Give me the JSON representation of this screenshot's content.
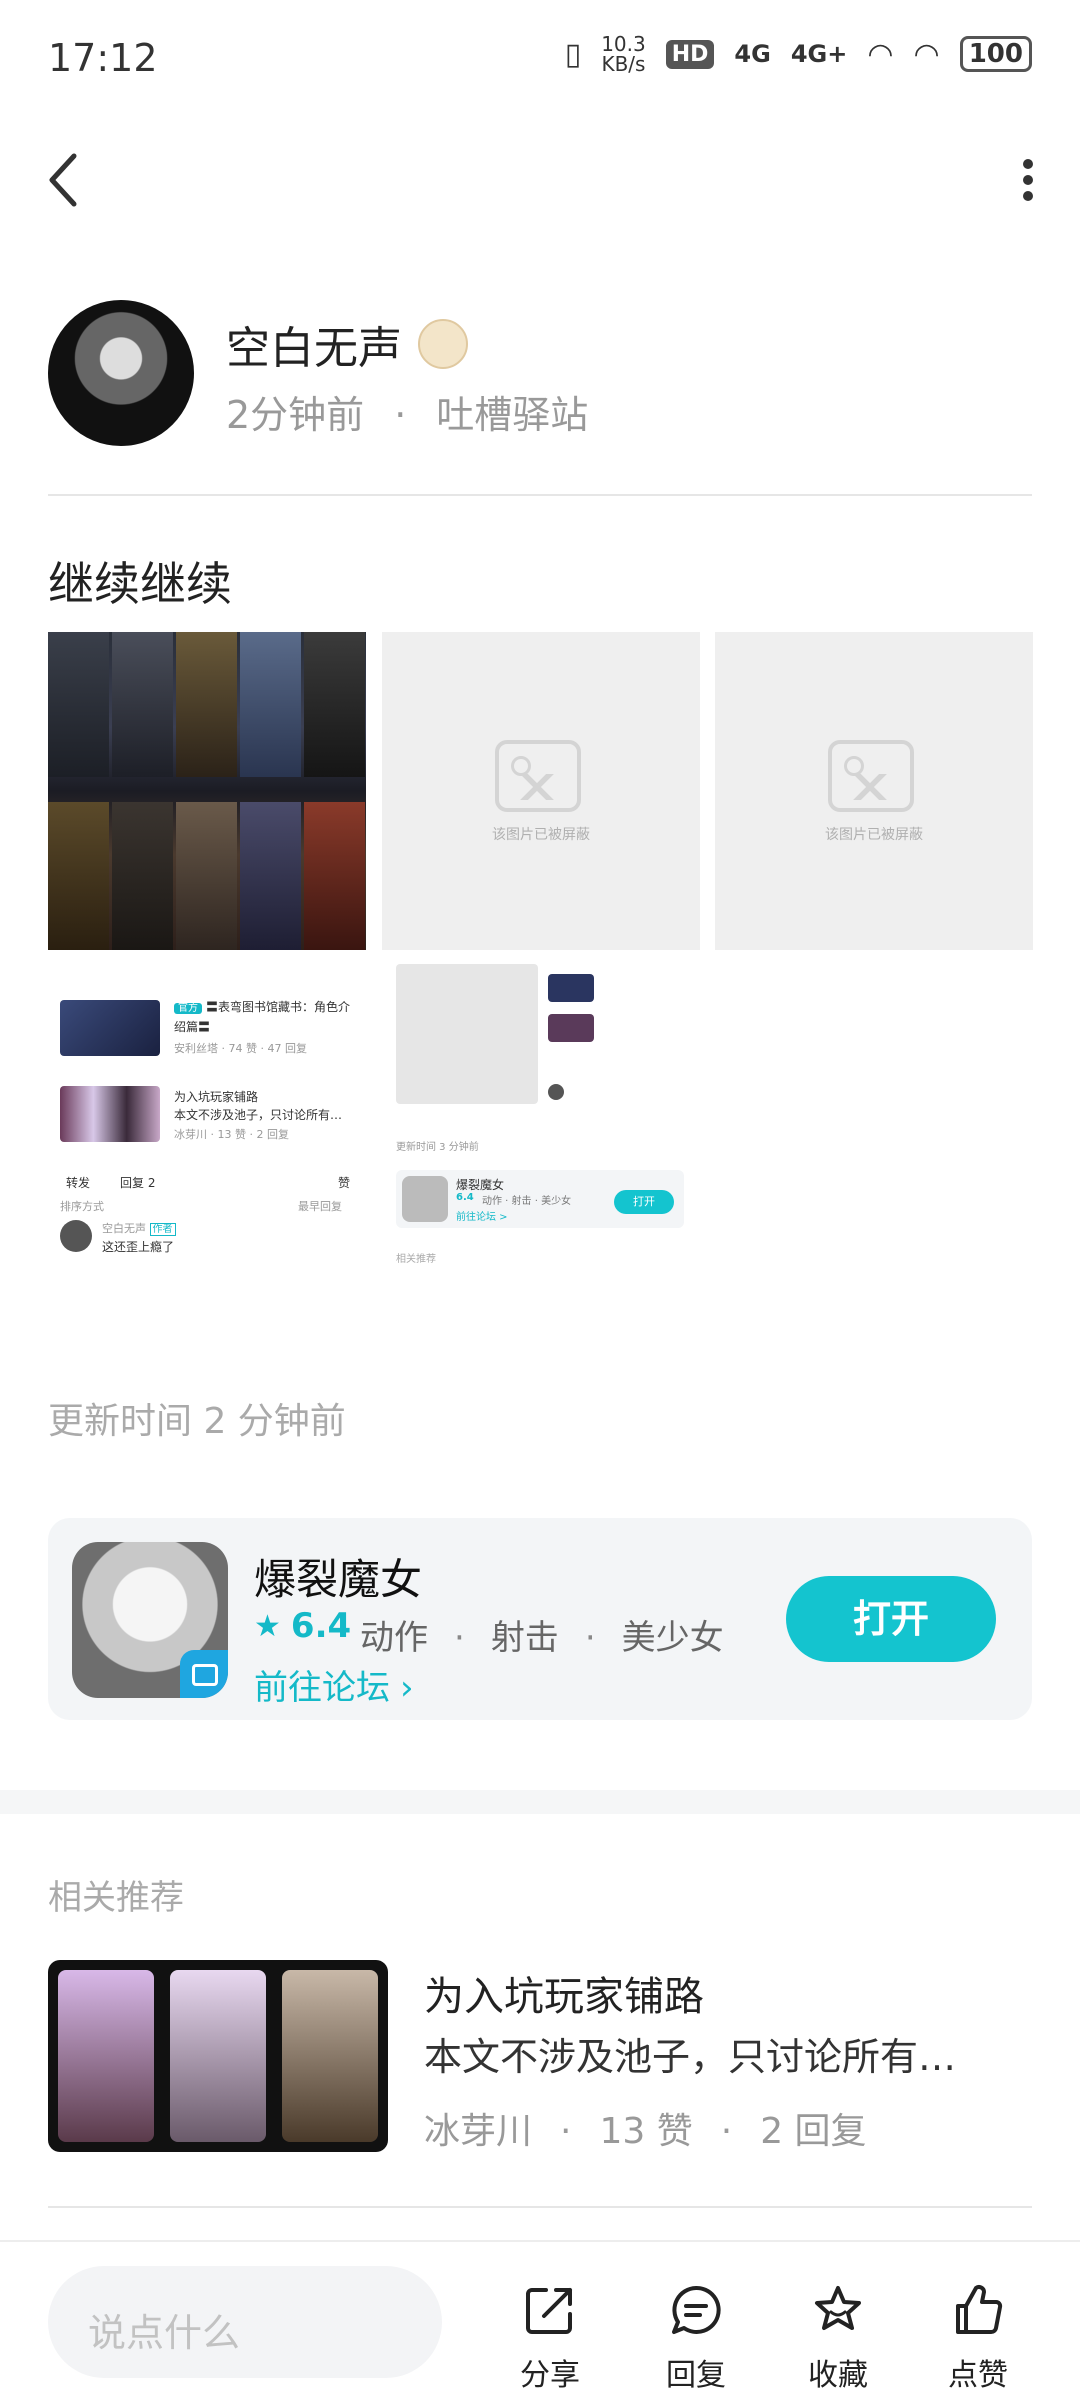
{
  "status_bar": {
    "time": "17:12",
    "net_speed": "10.3",
    "net_unit": "KB/s",
    "hd": "HD",
    "signal1": "4G",
    "signal2": "4G+",
    "battery": "100"
  },
  "author": {
    "name": "空白无声",
    "time_ago": "2分钟前",
    "separator": "·",
    "board": "吐槽驿站"
  },
  "post": {
    "title": "继续继续",
    "blocked_text": "该图片已被屏蔽",
    "update_time": "更新时间 2 分钟前"
  },
  "screenshot1": {
    "item1_tag": "官方",
    "item1_title": "〓表弯图书馆藏书：角色介绍篇〓",
    "item1_meta": "安利丝塔 · 74 赞 · 47 回复",
    "item2_title": "为入坑玩家铺路",
    "item2_desc": "本文不涉及池子，只讨论所有…",
    "item2_meta": "冰芽川 · 13 赞 · 2 回复",
    "tab_forward": "转发",
    "tab_reply": "回复 2",
    "tab_like": "赞",
    "sort_label": "排序方式",
    "sort_value": "最早回复",
    "commenter": "空白无声",
    "author_badge": "作者",
    "comment": "这还歪上瘾了"
  },
  "screenshot2": {
    "update": "更新时间 3 分钟前",
    "app_name": "爆裂魔女",
    "app_rating": "6.4",
    "app_tags": "动作 · 射击 · 美少女",
    "forum": "前往论坛 >",
    "open": "打开",
    "related": "相关推荐"
  },
  "app_card": {
    "name": "爆裂魔女",
    "rating": "6.4",
    "tags": [
      "动作",
      "射击",
      "美少女"
    ],
    "forum_link": "前往论坛",
    "open_label": "打开",
    "accent_color": "#14c4cf"
  },
  "related": {
    "label": "相关推荐",
    "title": "为入坑玩家铺路",
    "desc": "本文不涉及池子，只讨论所有…",
    "author": "冰芽川",
    "likes": "13 赞",
    "replies": "2 回复"
  },
  "bottom_bar": {
    "input_placeholder": "说点什么",
    "share": "分享",
    "reply": "回复",
    "favorite": "收藏",
    "like": "点赞"
  }
}
